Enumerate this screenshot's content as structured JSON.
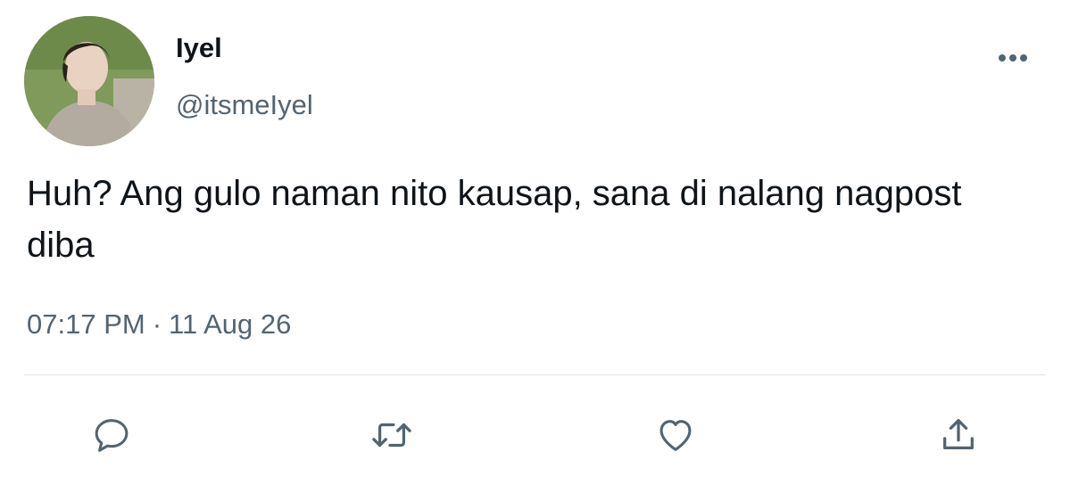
{
  "tweet": {
    "author": {
      "display_name": "Iyel",
      "handle": "@itsmeIyel"
    },
    "text": "Huh? Ang gulo naman nito kausap, sana di nalang nagpost diba",
    "time": "07:17 PM",
    "separator": "·",
    "date": "11 Aug 26"
  },
  "icons": {
    "more": "more-horizontal-icon",
    "reply": "reply-icon",
    "retweet": "retweet-icon",
    "like": "heart-icon",
    "share": "share-icon"
  },
  "colors": {
    "text": "#0f1419",
    "secondary": "#536471",
    "divider": "#dfe3e6"
  }
}
